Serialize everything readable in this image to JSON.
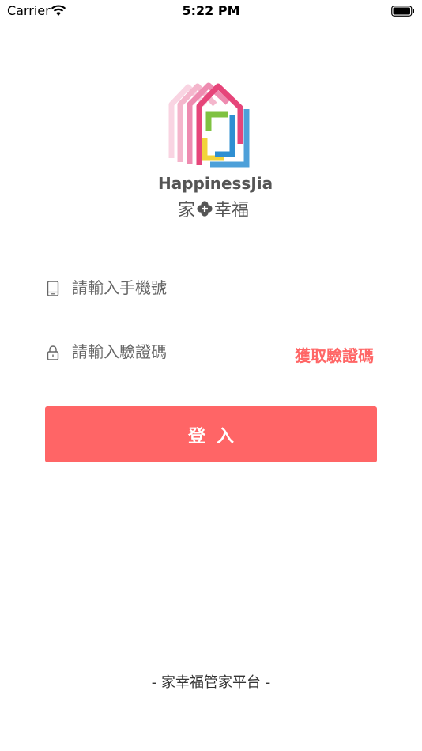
{
  "status_bar": {
    "carrier": "Carrier",
    "time": "5:22 PM",
    "icons": [
      "wifi-icon",
      "battery-icon"
    ]
  },
  "logo": {
    "brand_en": "HappinessJia",
    "brand_cn_left": "家",
    "brand_cn_right": "幸福",
    "colors": {
      "pink": "#e6457a",
      "light_pink": "#f4b6cc",
      "blue": "#2e8fd2",
      "green": "#7fc241",
      "yellow": "#f2d33b",
      "text": "#555555"
    }
  },
  "login_form": {
    "phone": {
      "placeholder": "請輸入手機號",
      "value": "",
      "icon": "phone-icon"
    },
    "code": {
      "placeholder": "請輸入驗證碼",
      "value": "",
      "icon": "lock-icon"
    },
    "get_code_label": "獲取驗證碼",
    "login_label": "登入"
  },
  "footer": {
    "text": "-  家幸福管家平台  -"
  },
  "colors": {
    "accent": "#ff6566",
    "divider": "#e6e6e6"
  }
}
